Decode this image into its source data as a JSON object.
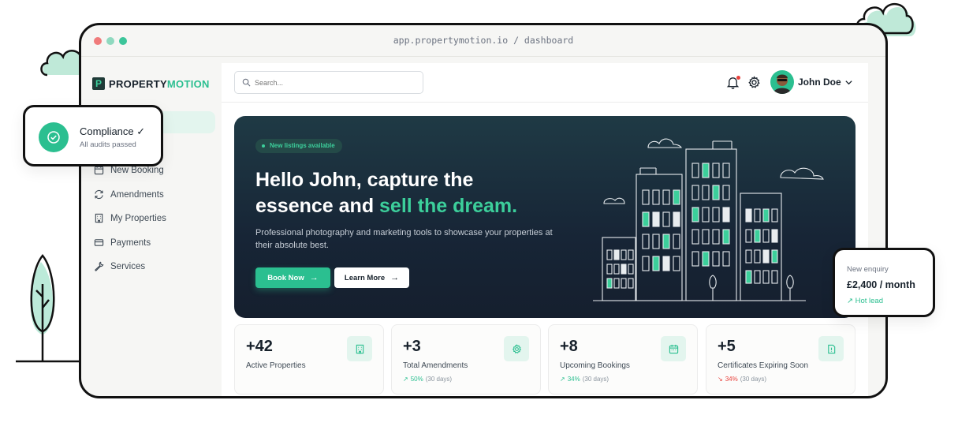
{
  "browser": {
    "url": "app.propertymotion.io / dashboard"
  },
  "logo": {
    "text_main": "PROPERTY",
    "text_accent": "MOTION",
    "mark": "P"
  },
  "sidebar": {
    "items": [
      {
        "label": "New Booking",
        "icon": "calendar-icon"
      },
      {
        "label": "Amendments",
        "icon": "refresh-icon"
      },
      {
        "label": "My Properties",
        "icon": "building-icon"
      },
      {
        "label": "Payments",
        "icon": "credit-card-icon"
      },
      {
        "label": "Services",
        "icon": "wrench-icon"
      }
    ]
  },
  "header": {
    "search_placeholder": "Search...",
    "user_name": "John Doe"
  },
  "hero": {
    "pill": "New listings available",
    "title_line1": "Hello John, capture the",
    "title_line2_start": "essence and ",
    "title_accent": "sell the dream.",
    "subtitle": "Professional photography and marketing tools to showcase your properties at their absolute best.",
    "btn_primary": "Book Now",
    "btn_secondary": "Learn More"
  },
  "stats": [
    {
      "value": "+42",
      "label": "Active Properties",
      "icon": "building-icon"
    },
    {
      "value": "+3",
      "label": "Total Amendments",
      "icon": "gear-icon",
      "trend": "50%",
      "period": "(30 days)",
      "direction": "up"
    },
    {
      "value": "+8",
      "label": "Upcoming Bookings",
      "icon": "calendar-icon",
      "trend": "34%",
      "period": "(30 days)",
      "direction": "up"
    },
    {
      "value": "+5",
      "label": "Certificates Expiring Soon",
      "icon": "document-icon",
      "trend": "34%",
      "period": "(30 days)",
      "direction": "down"
    }
  ],
  "compliance": {
    "title": "Compliance ✓",
    "subtitle": "All audits passed"
  },
  "enquiry": {
    "label": "New enquiry",
    "price": "£2,400 / month",
    "lead": "↗ Hot lead"
  },
  "colors": {
    "accent": "#2bbf90",
    "hero_bg": "#172536",
    "trend_down": "#e8413c"
  }
}
